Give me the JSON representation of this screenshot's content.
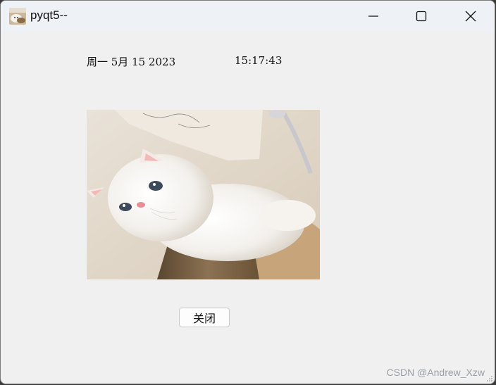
{
  "window": {
    "title": "pyqt5--"
  },
  "clock": {
    "date": "周一 5月 15 2023",
    "time": "15:17:43"
  },
  "image": {
    "subject": "white fluffy cat"
  },
  "actions": {
    "close_label": "关闭"
  },
  "watermark": {
    "text": "CSDN @Andrew_Xzw"
  },
  "icons": {
    "app": "cat-thumbnail-icon",
    "minimize": "minimize-icon",
    "maximize": "maximize-icon",
    "close": "close-icon"
  }
}
